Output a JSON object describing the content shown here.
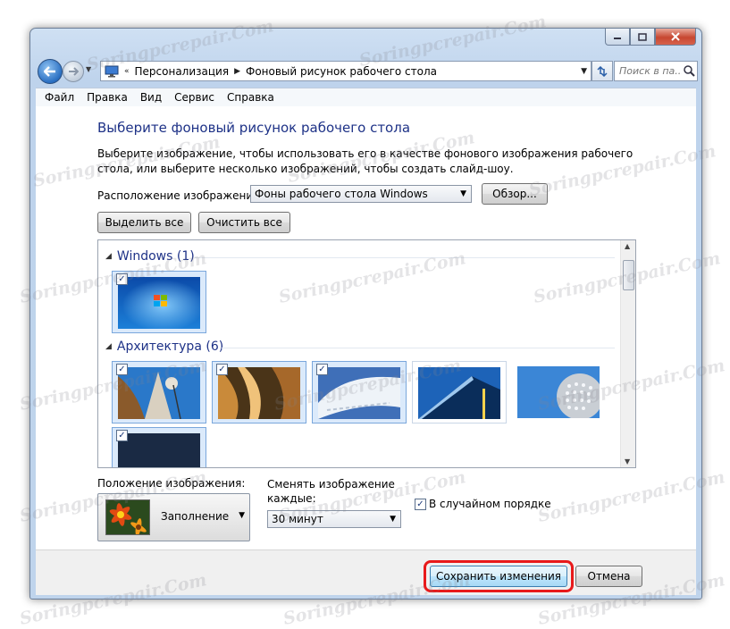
{
  "navigation": {
    "breadcrumb_sep": "«",
    "breadcrumb_1": "Персонализация",
    "breadcrumb_2": "Фоновый рисунок рабочего стола",
    "search_placeholder": "Поиск в па..."
  },
  "menu": [
    "Файл",
    "Правка",
    "Вид",
    "Сервис",
    "Справка"
  ],
  "main": {
    "title": "Выберите фоновый рисунок рабочего стола",
    "description": "Выберите изображение, чтобы использовать его в качестве фонового изображения рабочего стола, или выберите несколько изображений, чтобы создать слайд-шоу.",
    "location_label": "Расположение изображения:",
    "location_value": "Фоны рабочего стола Windows",
    "browse_button": "Обзор...",
    "select_all_button": "Выделить все",
    "clear_all_button": "Очистить все"
  },
  "gallery": {
    "groups": [
      {
        "name": "Windows (1)",
        "checked": [
          true
        ]
      },
      {
        "name": "Архитектура (6)",
        "checked": [
          true,
          true,
          true,
          false,
          false,
          true
        ]
      }
    ]
  },
  "options": {
    "position_label": "Положение изображения:",
    "position_value": "Заполнение",
    "interval_label_line1": "Сменять изображение",
    "interval_label_line2": "каждые:",
    "interval_value": "30 минут",
    "shuffle_label": "В случайном порядке",
    "shuffle_checked": true
  },
  "footer": {
    "save_button": "Сохранить изменения",
    "cancel_button": "Отмена"
  },
  "watermark": "Soringpcrepair.Com",
  "colors": {
    "title": "#1e3287",
    "highlight": "#e8191a",
    "selection": "#dbeafb"
  }
}
